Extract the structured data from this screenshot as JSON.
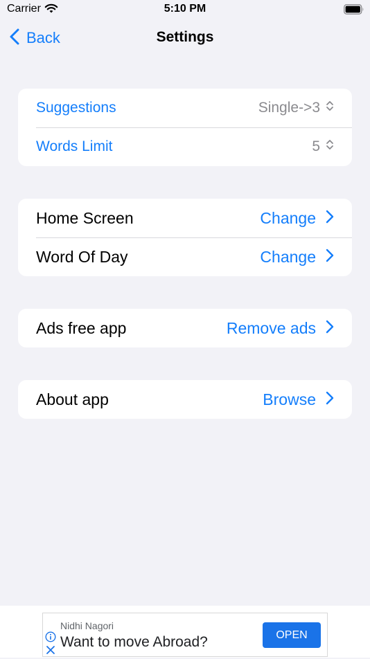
{
  "status_bar": {
    "carrier": "Carrier",
    "time": "5:10 PM"
  },
  "nav": {
    "back_label": "Back",
    "title": "Settings"
  },
  "groups": [
    {
      "rows": [
        {
          "label": "Suggestions",
          "value": "Single->3"
        },
        {
          "label": "Words Limit",
          "value": "5"
        }
      ]
    },
    {
      "rows": [
        {
          "label": "Home Screen",
          "value": "Change"
        },
        {
          "label": "Word Of Day",
          "value": "Change"
        }
      ]
    },
    {
      "rows": [
        {
          "label": "Ads free app",
          "value": "Remove ads"
        }
      ]
    },
    {
      "rows": [
        {
          "label": "About app",
          "value": "Browse"
        }
      ]
    }
  ],
  "ad": {
    "author": "Nidhi Nagori",
    "headline": "Want to move Abroad?",
    "cta": "OPEN"
  },
  "colors": {
    "accent": "#147efb",
    "background": "#f2f2f7",
    "ad_button": "#1a73e8"
  }
}
